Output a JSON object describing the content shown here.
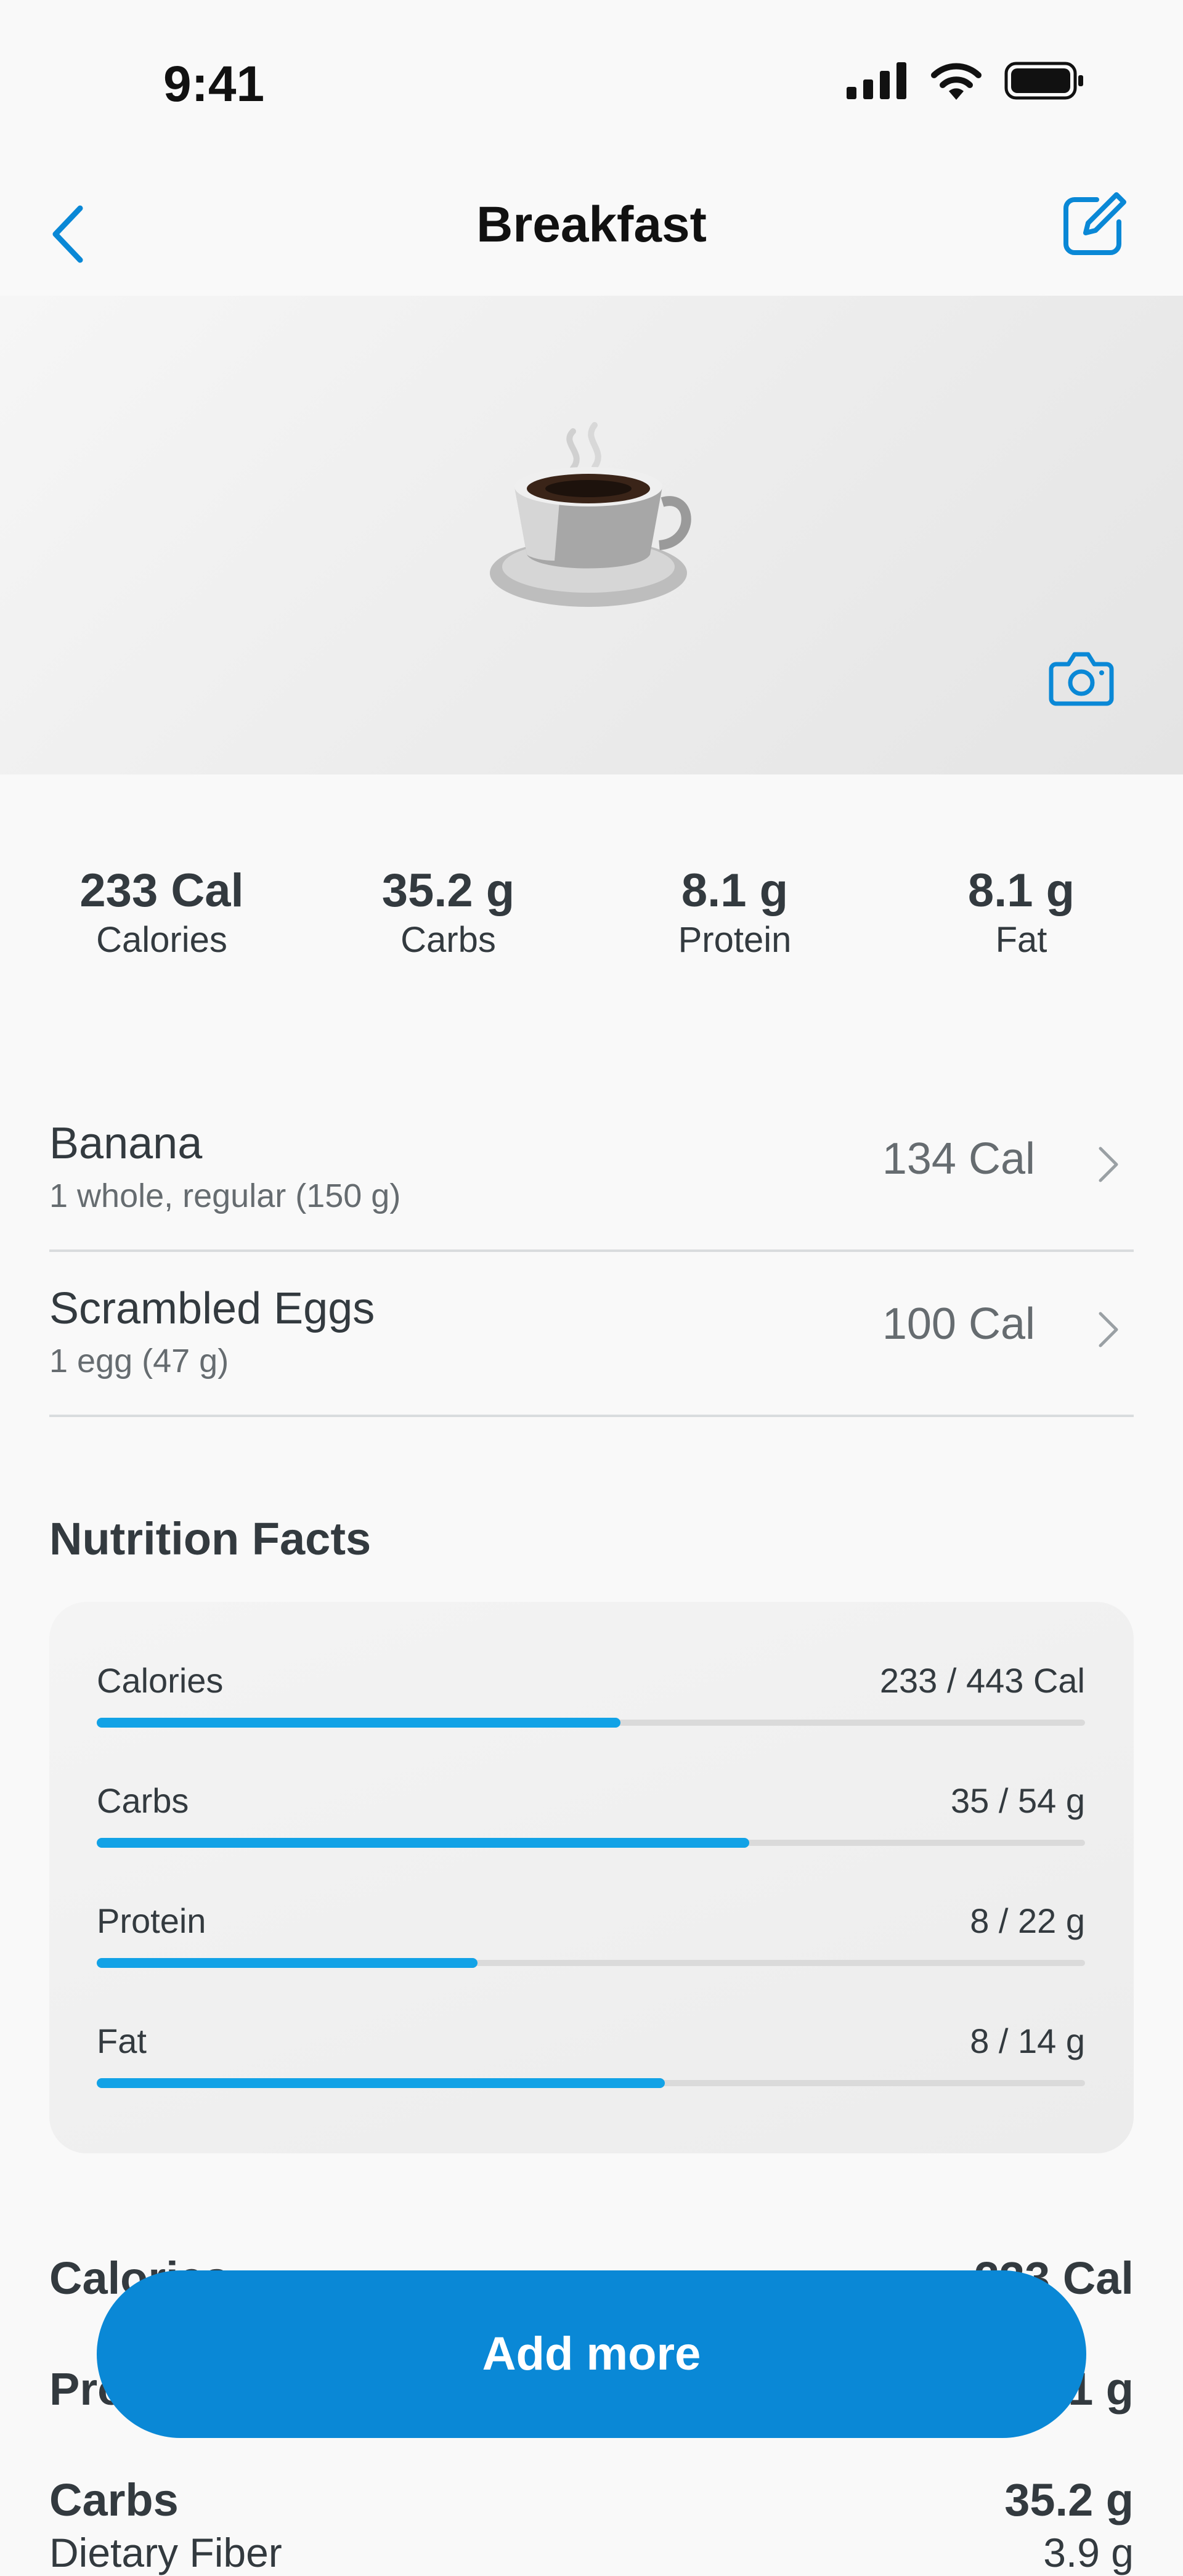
{
  "status_bar": {
    "time": "9:41"
  },
  "nav": {
    "title": "Breakfast"
  },
  "summary": [
    {
      "value": "233 Cal",
      "label": "Calories"
    },
    {
      "value": "35.2 g",
      "label": "Carbs"
    },
    {
      "value": "8.1 g",
      "label": "Protein"
    },
    {
      "value": "8.1 g",
      "label": "Fat"
    }
  ],
  "foods": [
    {
      "name": "Banana",
      "desc": "1 whole, regular (150 g)",
      "cal": "134 Cal"
    },
    {
      "name": "Scrambled Eggs",
      "desc": "1 egg (47 g)",
      "cal": "100 Cal"
    }
  ],
  "nutrition_facts": {
    "title": "Nutrition Facts",
    "bars": [
      {
        "label": "Calories",
        "value": "233 / 443 Cal",
        "fraction": 0.53
      },
      {
        "label": "Carbs",
        "value": "35 / 54 g",
        "fraction": 0.66
      },
      {
        "label": "Protein",
        "value": "8 / 22 g",
        "fraction": 0.385
      },
      {
        "label": "Fat",
        "value": "8 / 14 g",
        "fraction": 0.575
      }
    ]
  },
  "details": [
    {
      "label": "Calories",
      "value": "233 Cal"
    },
    {
      "label": "Protein",
      "value": "8.1 g"
    },
    {
      "label": "Carbs",
      "value": "35.2 g"
    },
    {
      "label": "Dietary Fiber",
      "value": "3.9 g"
    }
  ],
  "cta": {
    "label": "Add more"
  },
  "colors": {
    "accent": "#0a88d6",
    "bar": "#12a2e6",
    "text": "#333a3f"
  },
  "icons": [
    "signal-icon",
    "wifi-icon",
    "battery-icon",
    "back-chevron-icon",
    "edit-icon",
    "coffee-cup-icon",
    "camera-icon",
    "chevron-right-icon"
  ]
}
